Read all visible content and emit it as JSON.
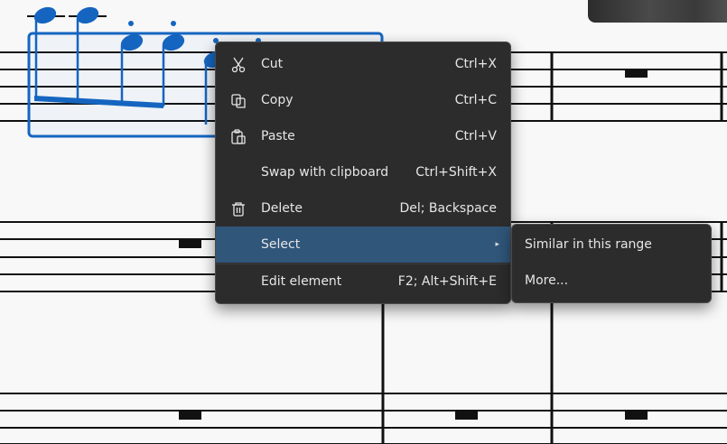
{
  "context_menu": {
    "items": [
      {
        "label": "Cut",
        "shortcut": "Ctrl+X",
        "icon": "scissors-icon"
      },
      {
        "label": "Copy",
        "shortcut": "Ctrl+C",
        "icon": "copy-icon"
      },
      {
        "label": "Paste",
        "shortcut": "Ctrl+V",
        "icon": "paste-icon"
      },
      {
        "label": "Swap with clipboard",
        "shortcut": "Ctrl+Shift+X"
      },
      {
        "label": "Delete",
        "shortcut": "Del; Backspace",
        "icon": "trash-icon"
      },
      {
        "label": "Select",
        "shortcut": ""
      },
      {
        "label": "Edit element",
        "shortcut": "F2; Alt+Shift+E"
      }
    ],
    "active_item": "Select",
    "submenu_arrow": "▸"
  },
  "submenu": {
    "items": [
      {
        "label": "Similar in this range"
      },
      {
        "label": "More..."
      }
    ]
  },
  "colors": {
    "selection_blue": "#1565c0",
    "menu_bg": "#2c2c2c",
    "highlight": "#30567a",
    "staff_line": "#000000"
  }
}
